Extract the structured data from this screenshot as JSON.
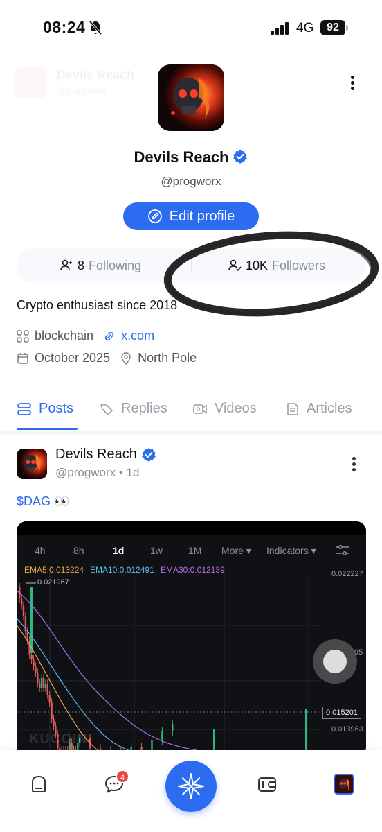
{
  "status_bar": {
    "time": "08:24",
    "network": "4G",
    "battery": "92"
  },
  "profile": {
    "name": "Devils Reach",
    "handle": "@progworx",
    "edit_label": "Edit profile",
    "following_count": "8",
    "following_label": "Following",
    "followers_count": "10K",
    "followers_label": "Followers",
    "bio": "Crypto enthusiast since 2018",
    "tag": "blockchain",
    "link": "x.com",
    "joined": "October 2025",
    "location": "North Pole"
  },
  "tabs": [
    {
      "label": "Posts",
      "icon": "posts-icon",
      "active": true
    },
    {
      "label": "Replies",
      "icon": "replies-icon",
      "active": false
    },
    {
      "label": "Videos",
      "icon": "videos-icon",
      "active": false
    },
    {
      "label": "Articles",
      "icon": "articles-icon",
      "active": false
    }
  ],
  "post": {
    "author": "Devils Reach",
    "handle": "@progworx",
    "age": "1d",
    "ticker": "$DAG",
    "emoji": "👀",
    "chart": {
      "timeframes": [
        "4h",
        "8h",
        "1d",
        "1w",
        "1M"
      ],
      "active_timeframe": "1d",
      "more": "More ▾",
      "indicators": "Indicators ▾",
      "ema5": "EMA5:0.013224",
      "ema10": "EMA10:0.012491",
      "ema30": "EMA30:0.012139",
      "high_label": "0.021967",
      "price_top": "0.022227",
      "price_mid": "95",
      "price_current": "0.015201",
      "price_low": "0.013963",
      "watermark": "KUCOIN",
      "colors": {
        "ema5": "#f0a94a",
        "ema10": "#5bb8f0",
        "ema30": "#b06ee8",
        "up": "#2fb67c",
        "down": "#e55a5a"
      }
    }
  },
  "bottom_nav": {
    "badge_count": "4",
    "items": [
      "home-icon",
      "chat-icon",
      "star-logo-icon",
      "wallet-icon",
      "profile-avatar"
    ]
  },
  "colors": {
    "accent": "#2b6cf0",
    "badge": "#ef4444"
  }
}
